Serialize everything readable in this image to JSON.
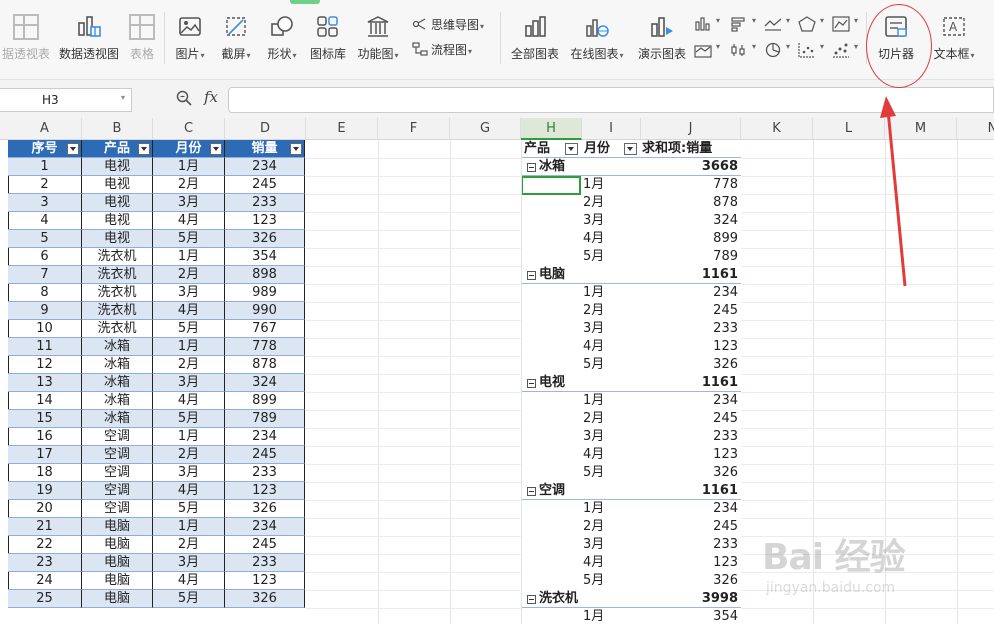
{
  "ribbon": {
    "buttons": [
      {
        "id": "pivot-report",
        "label": "据透视表",
        "dim": true
      },
      {
        "id": "pivot-chart",
        "label": "数据透视图"
      },
      {
        "id": "table",
        "label": "表格",
        "dim": true
      },
      {
        "id": "picture",
        "label": "图片",
        "caret": true
      },
      {
        "id": "screenshot",
        "label": "截屏",
        "caret": true
      },
      {
        "id": "shapes",
        "label": "形状",
        "caret": true
      },
      {
        "id": "icon-library",
        "label": "图标库"
      },
      {
        "id": "function-chart",
        "label": "功能图",
        "caret": true
      },
      {
        "id": "all-charts",
        "label": "全部图表"
      },
      {
        "id": "online-charts",
        "label": "在线图表",
        "caret": true
      },
      {
        "id": "demo-charts",
        "label": "演示图表"
      },
      {
        "id": "slicer",
        "label": "切片器"
      },
      {
        "id": "textbox",
        "label": "文本框",
        "caret": true
      }
    ],
    "small": {
      "mindmap": "思维导图",
      "flowchart": "流程图"
    }
  },
  "formula_bar": {
    "name_box": "H3",
    "fx": "fx",
    "formula": ""
  },
  "columns": [
    "A",
    "B",
    "C",
    "D",
    "E",
    "F",
    "G",
    "H",
    "I",
    "J",
    "K",
    "L",
    "M",
    "N"
  ],
  "selected_column": "H",
  "source_table": {
    "headers": [
      "序号",
      "产品",
      "月份",
      "销量"
    ],
    "rows": [
      [
        "1",
        "电视",
        "1月",
        "234"
      ],
      [
        "2",
        "电视",
        "2月",
        "245"
      ],
      [
        "3",
        "电视",
        "3月",
        "233"
      ],
      [
        "4",
        "电视",
        "4月",
        "123"
      ],
      [
        "5",
        "电视",
        "5月",
        "326"
      ],
      [
        "6",
        "洗衣机",
        "1月",
        "354"
      ],
      [
        "7",
        "洗衣机",
        "2月",
        "898"
      ],
      [
        "8",
        "洗衣机",
        "3月",
        "989"
      ],
      [
        "9",
        "洗衣机",
        "4月",
        "990"
      ],
      [
        "10",
        "洗衣机",
        "5月",
        "767"
      ],
      [
        "11",
        "冰箱",
        "1月",
        "778"
      ],
      [
        "12",
        "冰箱",
        "2月",
        "878"
      ],
      [
        "13",
        "冰箱",
        "3月",
        "324"
      ],
      [
        "14",
        "冰箱",
        "4月",
        "899"
      ],
      [
        "15",
        "冰箱",
        "5月",
        "789"
      ],
      [
        "16",
        "空调",
        "1月",
        "234"
      ],
      [
        "17",
        "空调",
        "2月",
        "245"
      ],
      [
        "18",
        "空调",
        "3月",
        "233"
      ],
      [
        "19",
        "空调",
        "4月",
        "123"
      ],
      [
        "20",
        "空调",
        "5月",
        "326"
      ],
      [
        "21",
        "电脑",
        "1月",
        "234"
      ],
      [
        "22",
        "电脑",
        "2月",
        "245"
      ],
      [
        "23",
        "电脑",
        "3月",
        "233"
      ],
      [
        "24",
        "电脑",
        "4月",
        "123"
      ],
      [
        "25",
        "电脑",
        "5月",
        "326"
      ]
    ]
  },
  "pivot": {
    "header": {
      "product": "产品",
      "month": "月份",
      "sum": "求和项:销量"
    },
    "groups": [
      {
        "name": "冰箱",
        "total": "3668",
        "items": [
          [
            "1月",
            "778"
          ],
          [
            "2月",
            "878"
          ],
          [
            "3月",
            "324"
          ],
          [
            "4月",
            "899"
          ],
          [
            "5月",
            "789"
          ]
        ]
      },
      {
        "name": "电脑",
        "total": "1161",
        "items": [
          [
            "1月",
            "234"
          ],
          [
            "2月",
            "245"
          ],
          [
            "3月",
            "233"
          ],
          [
            "4月",
            "123"
          ],
          [
            "5月",
            "326"
          ]
        ]
      },
      {
        "name": "电视",
        "total": "1161",
        "items": [
          [
            "1月",
            "234"
          ],
          [
            "2月",
            "245"
          ],
          [
            "3月",
            "233"
          ],
          [
            "4月",
            "123"
          ],
          [
            "5月",
            "326"
          ]
        ]
      },
      {
        "name": "空调",
        "total": "1161",
        "items": [
          [
            "1月",
            "234"
          ],
          [
            "2月",
            "245"
          ],
          [
            "3月",
            "233"
          ],
          [
            "4月",
            "123"
          ],
          [
            "5月",
            "326"
          ]
        ]
      },
      {
        "name": "洗衣机",
        "total": "3998",
        "items": [
          [
            "1月",
            "354"
          ]
        ]
      }
    ]
  },
  "annotation_color": "#e23b3b",
  "accent_color": "#2d6bb5",
  "watermark": {
    "main": "Bai 经验",
    "sub": "jingyan.baidu.com"
  }
}
